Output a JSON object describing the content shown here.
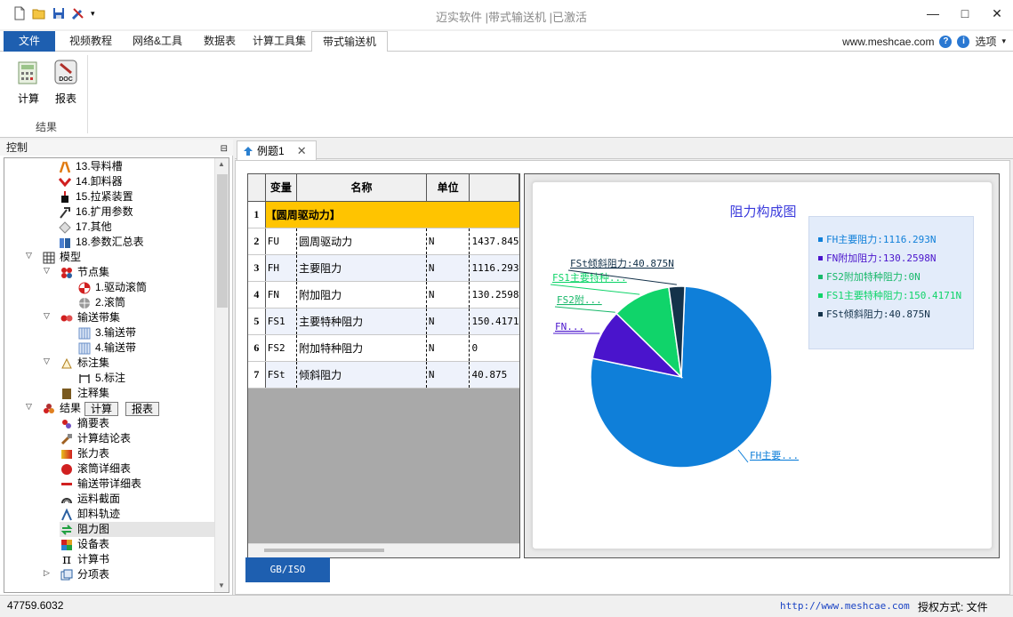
{
  "window": {
    "title": "迈实软件 |带式输送机 |已激活",
    "controls": [
      "—",
      "□",
      "✕"
    ]
  },
  "ribbon": {
    "tabs": [
      "文件",
      "视频教程",
      "网络&工具",
      "数据表",
      "计算工具集",
      "带式输送机"
    ],
    "active_tab": "带式输送机",
    "website": "www.meshcae.com",
    "options": "选项",
    "buttons": {
      "calc": "计算",
      "report": "报表"
    },
    "group_label": "结果"
  },
  "left_panel": {
    "title": "控制",
    "tree": [
      {
        "label": "13.导料槽",
        "icon": "chute-icon"
      },
      {
        "label": "14.卸料器",
        "icon": "unloader-icon"
      },
      {
        "label": "15.拉紧装置",
        "icon": "tensioner-icon"
      },
      {
        "label": "16.扩用参数",
        "icon": "params-icon"
      },
      {
        "label": "17.其他",
        "icon": "other-icon"
      },
      {
        "label": "18.参数汇总表",
        "icon": "summary-table-icon"
      },
      {
        "label": "模型",
        "icon": "model-icon"
      },
      {
        "label": "节点集",
        "icon": "node-set-icon"
      },
      {
        "label": "1.驱动滚筒",
        "icon": "drive-pulley-icon"
      },
      {
        "label": "2.滚筒",
        "icon": "pulley-icon"
      },
      {
        "label": "输送带集",
        "icon": "belt-set-icon"
      },
      {
        "label": "3.输送带",
        "icon": "belt-icon"
      },
      {
        "label": "4.输送带",
        "icon": "belt-icon"
      },
      {
        "label": "标注集",
        "icon": "annotation-set-icon"
      },
      {
        "label": "5.标注",
        "icon": "annotation-icon"
      },
      {
        "label": "注释集",
        "icon": "notes-icon"
      },
      {
        "label": "结果",
        "icon": "results-icon",
        "buttons": [
          "计算",
          "报表"
        ]
      },
      {
        "label": "摘要表",
        "icon": "summary-icon"
      },
      {
        "label": "计算结论表",
        "icon": "conclusion-icon"
      },
      {
        "label": "张力表",
        "icon": "tension-icon"
      },
      {
        "label": "滚筒详细表",
        "icon": "pulley-detail-icon"
      },
      {
        "label": "输送带详细表",
        "icon": "belt-detail-icon"
      },
      {
        "label": "运料截面",
        "icon": "cross-section-icon"
      },
      {
        "label": "卸料轨迹",
        "icon": "trajectory-icon"
      },
      {
        "label": "阻力图",
        "icon": "resistance-chart-icon"
      },
      {
        "label": "设备表",
        "icon": "equipment-icon"
      },
      {
        "label": "计算书",
        "icon": "pi-icon"
      },
      {
        "label": "分项表",
        "icon": "itemized-icon"
      }
    ]
  },
  "doc_tab": {
    "label": "例题1"
  },
  "grid": {
    "headers": [
      "变量",
      "名称",
      "单位"
    ],
    "group_row": {
      "num": "1",
      "label": "【圆周驱动力】"
    },
    "rows": [
      {
        "num": "2",
        "var": "FU",
        "name": "圆周驱动力",
        "unit": "N",
        "value": "1437.845"
      },
      {
        "num": "3",
        "var": "FH",
        "name": "主要阻力",
        "unit": "N",
        "value": "1116.293"
      },
      {
        "num": "4",
        "var": "FN",
        "name": "附加阻力",
        "unit": "N",
        "value": "130.2598"
      },
      {
        "num": "5",
        "var": "FS1",
        "name": "主要特种阻力",
        "unit": "N",
        "value": "150.4171"
      },
      {
        "num": "6",
        "var": "FS2",
        "name": "附加特种阻力",
        "unit": "N",
        "value": "0"
      },
      {
        "num": "7",
        "var": "FSt",
        "name": "倾斜阻力",
        "unit": "N",
        "value": "40.875"
      }
    ]
  },
  "chart_data": {
    "type": "pie",
    "title": "阻力构成图",
    "legend_position": "top-right",
    "slices": [
      {
        "name": "FH主要阻力",
        "value": 1116.293,
        "legend": "FH主要阻力:1116.293N",
        "label": "FH主要...",
        "color": "#0f7fd9"
      },
      {
        "name": "FN附加阻力",
        "value": 130.2598,
        "legend": "FN附加阻力:130.2598N",
        "label": "FN...",
        "color": "#4a14cc"
      },
      {
        "name": "FS2附加特种阻力",
        "value": 0,
        "legend": "FS2附加特种阻力:0N",
        "label": "FS2附...",
        "color": "#18b86a"
      },
      {
        "name": "FS1主要特种阻力",
        "value": 150.4171,
        "legend": "FS1主要特种阻力:150.4171N",
        "label": "FS1主要特种...",
        "color": "#10d46a"
      },
      {
        "name": "FSt倾斜阻力",
        "value": 40.875,
        "legend": "FSt倾斜阻力:40.875N",
        "label": "FSt倾斜阻力:40.875N",
        "color": "#14324a"
      }
    ]
  },
  "bottom_tab": {
    "label": "GB/ISO"
  },
  "status": {
    "left": "47759.6032",
    "url": "http://www.meshcae.com",
    "license": "授权方式: 文件"
  }
}
